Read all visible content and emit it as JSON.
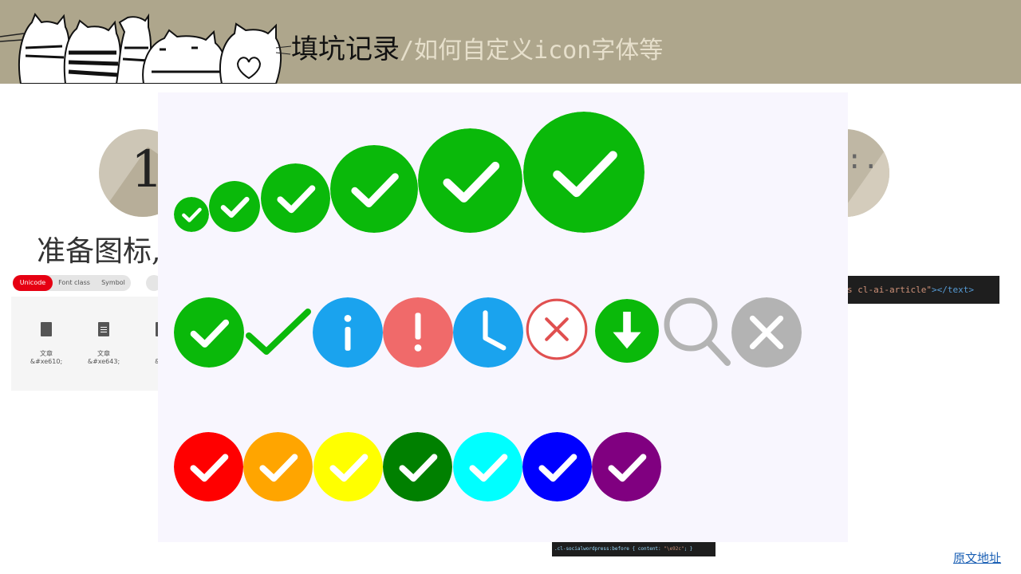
{
  "header": {
    "title_main": "填坑记录",
    "title_sub": "/如何自定义icon字体等"
  },
  "slide": {
    "number": "1",
    "section_title": "准备图标,"
  },
  "iconfont_tabs": [
    "Unicode",
    "Font class",
    "Symbol"
  ],
  "icon_items": [
    {
      "label": "文章",
      "code": "&#xe610;"
    },
    {
      "label": "文章",
      "code": "&#xe643;"
    },
    {
      "label": "文",
      "code": "&#:"
    }
  ],
  "code_strip": {
    "text": "s cl-ai-article\"",
    "tag": "></text>"
  },
  "code_bottom": {
    "selector": ".cl-socialwordpress:before { content: ",
    "value": "\"\\e92c\"",
    "end": "; }"
  },
  "footer": {
    "link": "原文地址"
  },
  "colors": {
    "header_bg": "#aea68c",
    "check_green": "#0ab90a",
    "info_blue": "#1aa3ee",
    "warn_red": "#f06a6a",
    "gray": "#b3b3b3",
    "tab_active": "#e60012"
  },
  "overlay_icons": {
    "row1": [
      "check-circle",
      "check-circle",
      "check-circle",
      "check-circle",
      "check-circle",
      "check-circle"
    ],
    "row2": [
      "check-circle-icon",
      "check-mark-icon",
      "info-icon",
      "warning-icon",
      "clock-icon",
      "error-outline-icon",
      "download-icon",
      "search-icon",
      "cancel-icon"
    ],
    "row3": [
      {
        "name": "red-check-icon",
        "color": "#ff0000"
      },
      {
        "name": "orange-check-icon",
        "color": "#ffa500"
      },
      {
        "name": "yellow-check-icon",
        "color": "#ffff00"
      },
      {
        "name": "darkgreen-check-icon",
        "color": "#008000"
      },
      {
        "name": "cyan-check-icon",
        "color": "#00ffff"
      },
      {
        "name": "blue-check-icon",
        "color": "#0000ff"
      },
      {
        "name": "purple-check-icon",
        "color": "#800080"
      }
    ]
  }
}
